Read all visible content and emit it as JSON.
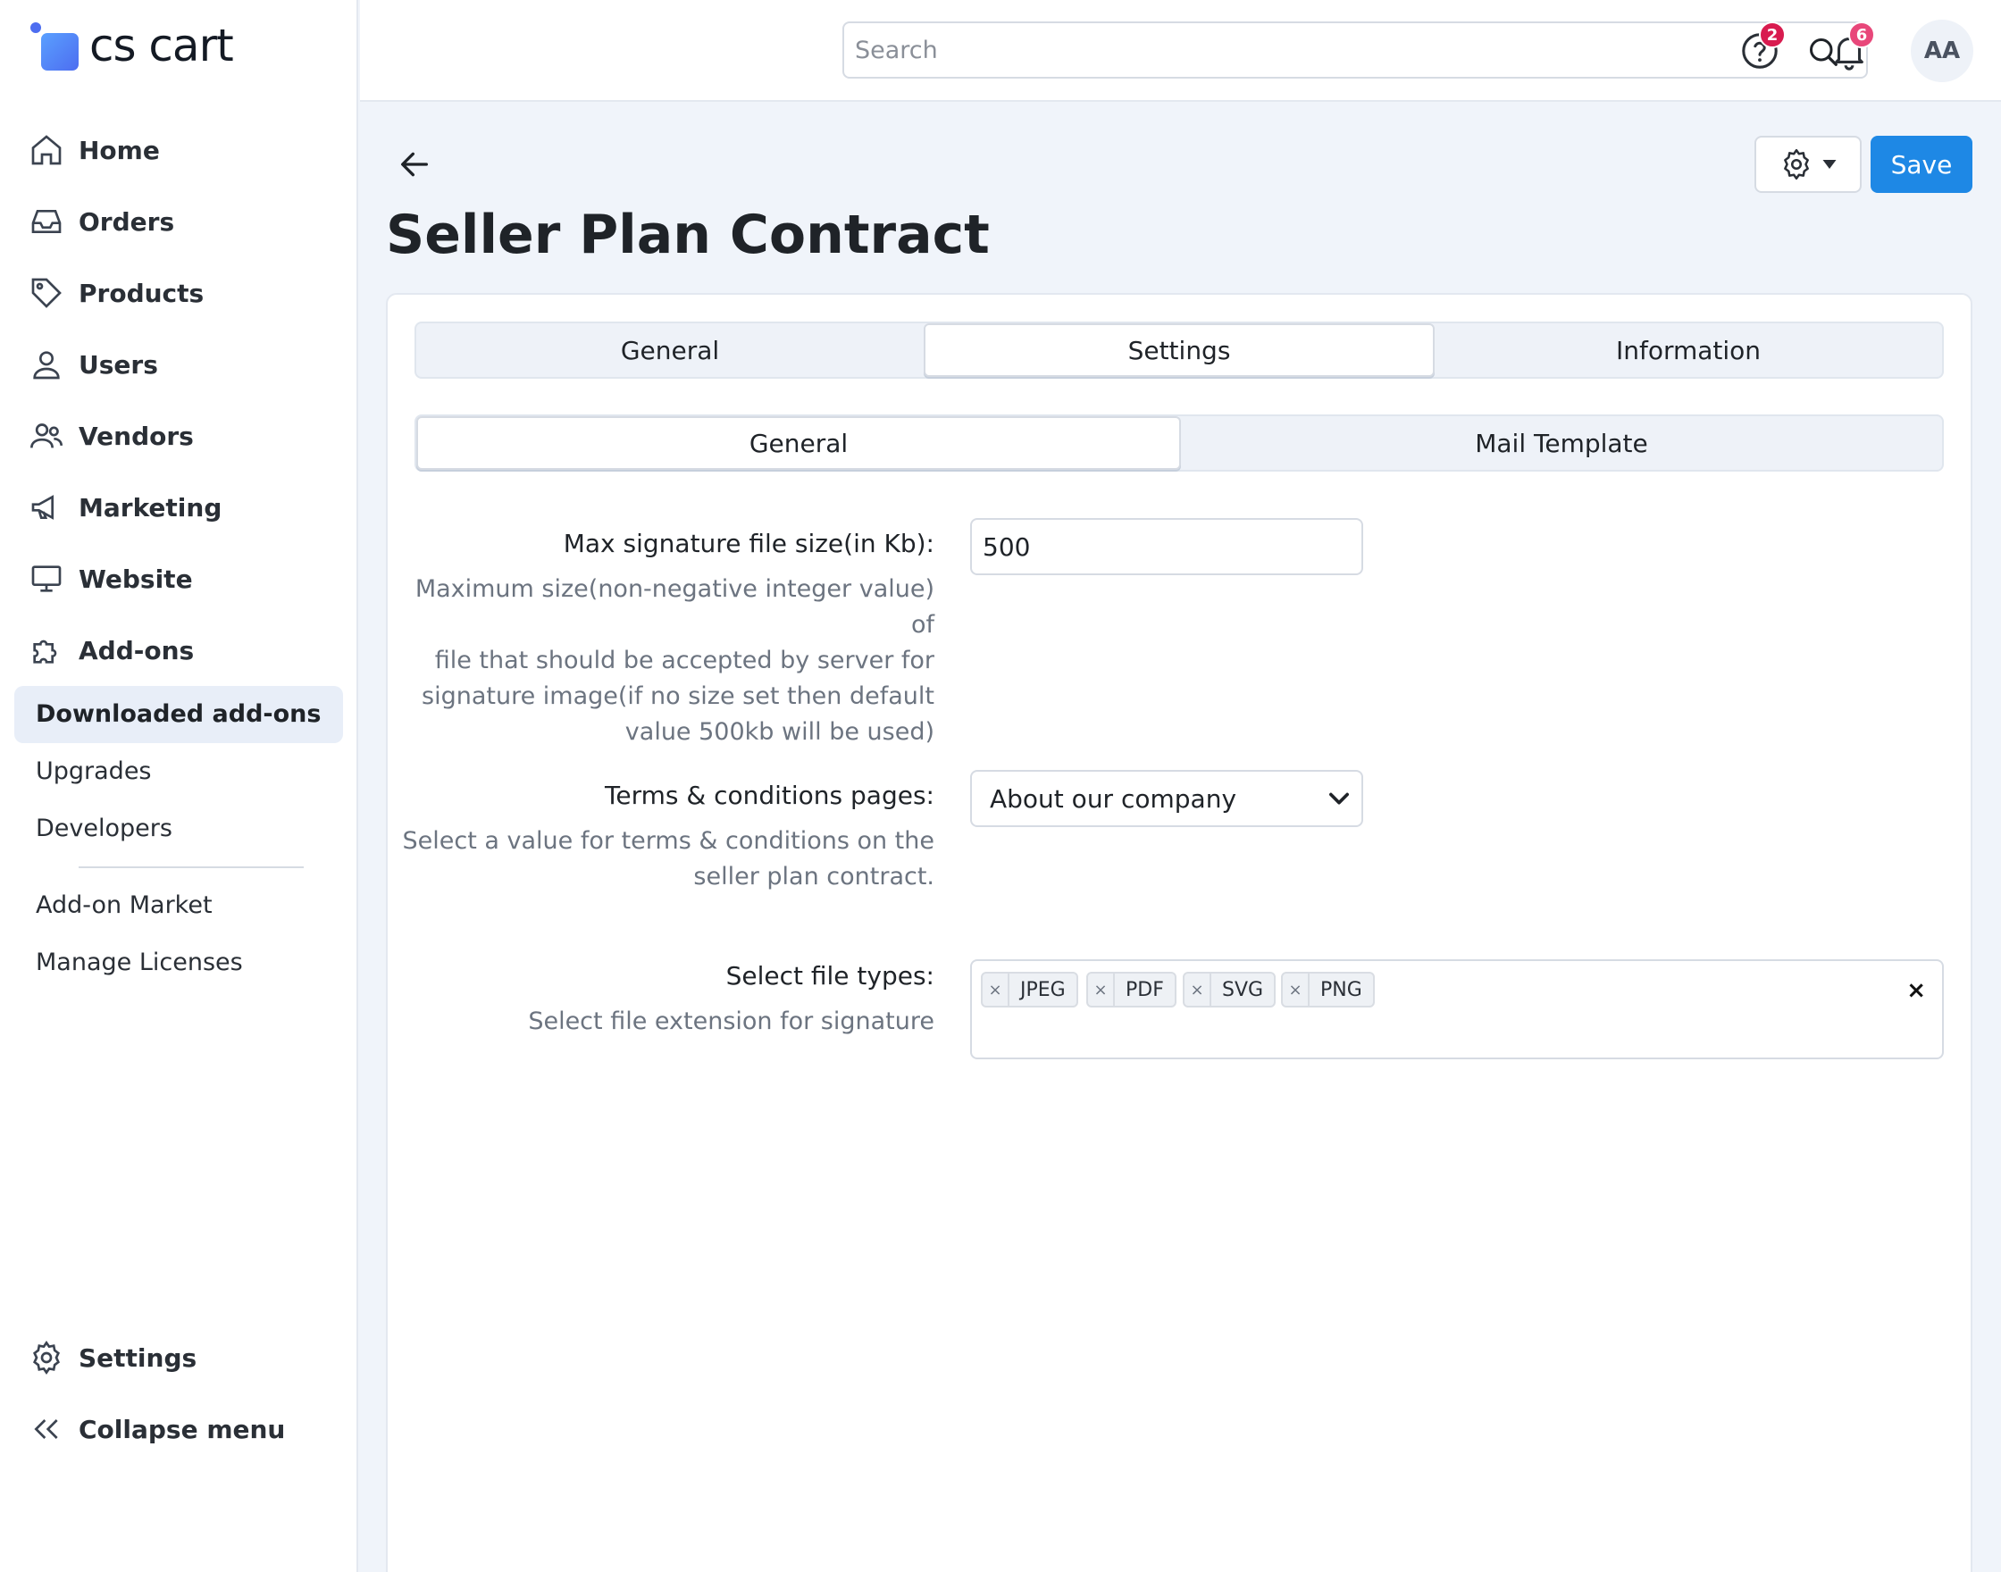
{
  "brand": {
    "logo_text": "cs cart"
  },
  "sidebar": {
    "items": [
      {
        "label": "Home",
        "icon": "home-icon"
      },
      {
        "label": "Orders",
        "icon": "inbox-icon"
      },
      {
        "label": "Products",
        "icon": "tag-icon"
      },
      {
        "label": "Users",
        "icon": "user-icon"
      },
      {
        "label": "Vendors",
        "icon": "users-icon"
      },
      {
        "label": "Marketing",
        "icon": "megaphone-icon"
      },
      {
        "label": "Website",
        "icon": "monitor-icon"
      },
      {
        "label": "Add-ons",
        "icon": "puzzle-icon"
      }
    ],
    "sub_items": {
      "active": "Downloaded add-ons",
      "upgrades": "Upgrades",
      "developers": "Developers",
      "market": "Add-on Market",
      "licenses": "Manage Licenses"
    },
    "bottom": {
      "settings": "Settings",
      "collapse": "Collapse menu"
    }
  },
  "header": {
    "search_placeholder": "Search",
    "help_badge": "2",
    "notifications_badge": "6",
    "avatar_initials": "AA"
  },
  "page": {
    "title": "Seller Plan Contract",
    "save_label": "Save"
  },
  "tabs": {
    "primary": [
      "General",
      "Settings",
      "Information"
    ],
    "primary_active": "Settings",
    "secondary": [
      "General",
      "Mail Template"
    ],
    "secondary_active": "General"
  },
  "form": {
    "max_size": {
      "label": "Max signature file size(in Kb):",
      "value": "500",
      "help": [
        "Maximum size(non-negative integer value) of",
        "file that should be accepted by server for",
        "signature image(if no size set then default",
        "value 500kb will be used)"
      ]
    },
    "terms": {
      "label": "Terms & conditions pages:",
      "value": "About our company",
      "help": [
        "Select a value for terms & conditions on the",
        "seller plan contract."
      ]
    },
    "file_types": {
      "label": "Select file types:",
      "help": "Select file extension for signature",
      "tags": [
        "JPEG",
        "PDF",
        "SVG",
        "PNG"
      ],
      "remove_glyph": "×",
      "clear_glyph": "×"
    }
  },
  "colors": {
    "accent": "#1e88e5",
    "help_badge": "#d81b4f",
    "notif_badge": "#e8477a"
  }
}
